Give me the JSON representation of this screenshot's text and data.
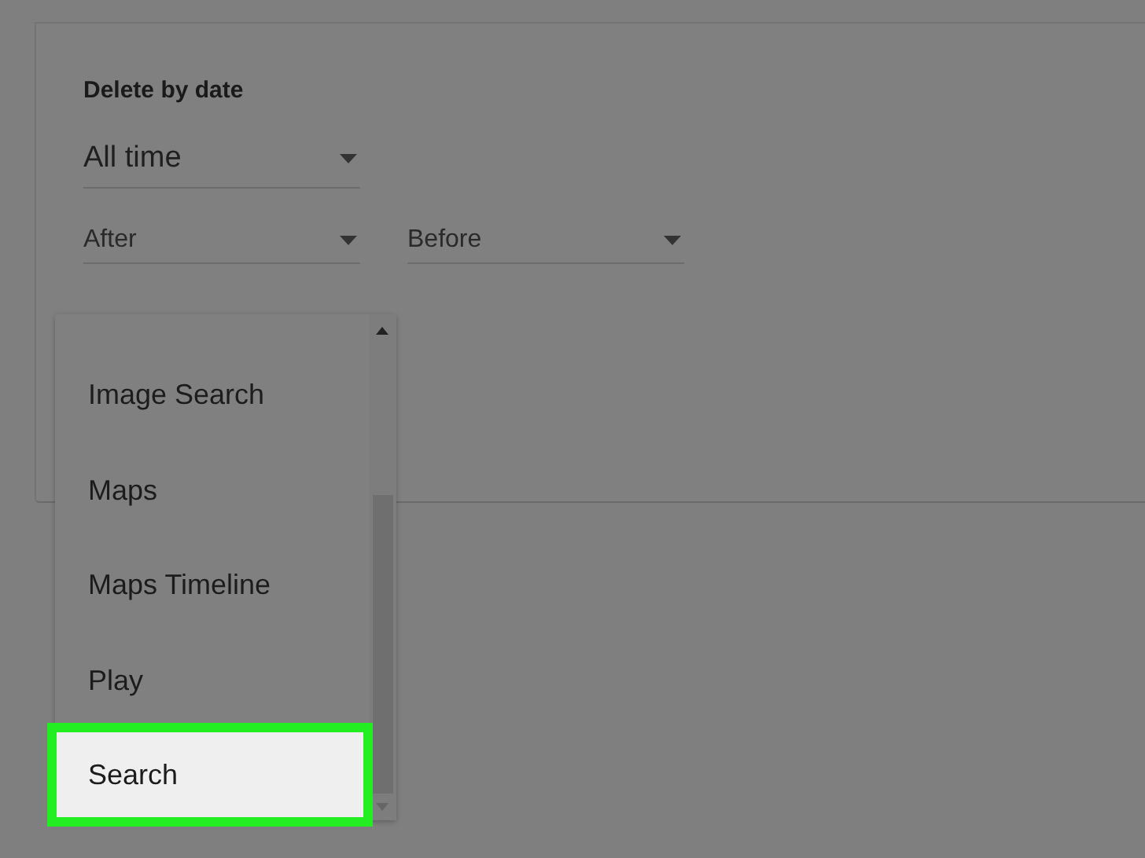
{
  "section": {
    "title": "Delete by date"
  },
  "range_dropdown": {
    "value": "All time"
  },
  "date_fields": [
    {
      "placeholder": "After"
    },
    {
      "placeholder": "Before"
    }
  ],
  "product_menu": {
    "items": [
      {
        "label": "Image Search",
        "selected": false
      },
      {
        "label": "Maps",
        "selected": false
      },
      {
        "label": "Maps Timeline",
        "selected": false
      },
      {
        "label": "Play",
        "selected": false
      },
      {
        "label": "Search",
        "selected": true
      }
    ]
  }
}
